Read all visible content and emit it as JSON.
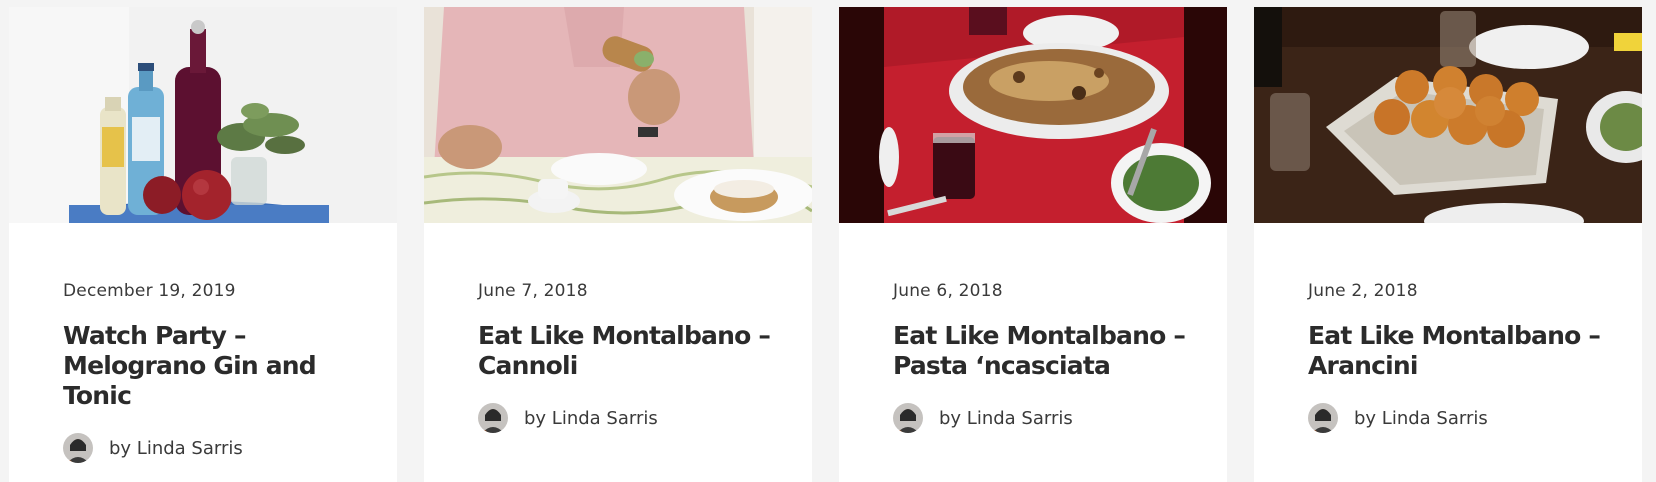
{
  "posts": [
    {
      "image": "gin-tonic-bottles-photo",
      "date": "December 19, 2019",
      "title": "Watch Party – Melograno Gin and Tonic",
      "author": "by Linda Sarris"
    },
    {
      "image": "man-eating-cannoli-photo",
      "date": "June 7, 2018",
      "title": "Eat Like Montalbano – Cannoli",
      "author": "by Linda Sarris"
    },
    {
      "image": "pasta-ncasciata-dish-photo",
      "date": "June 6, 2018",
      "title": "Eat Like Montalbano – Pasta ‘ncasciata",
      "author": "by Linda Sarris"
    },
    {
      "image": "arancini-platter-photo",
      "date": "June 2, 2018",
      "title": "Eat Like Montalbano – Arancini",
      "author": "by Linda Sarris"
    }
  ],
  "colors": {
    "page_background": "#f4f4f4",
    "card_background": "#ffffff",
    "title_text": "#2b2b2b",
    "meta_text": "#3a3a3a"
  }
}
